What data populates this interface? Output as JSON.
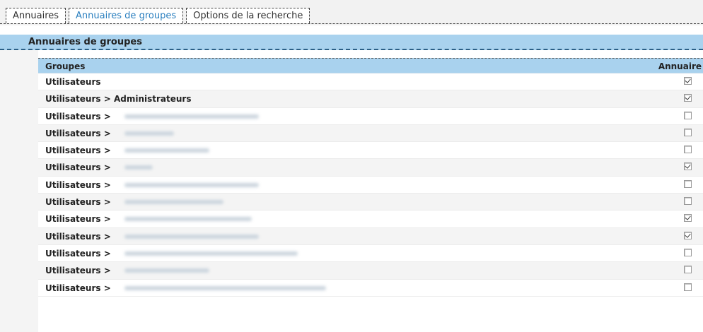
{
  "tabs": [
    {
      "label": "Annuaires",
      "active": false
    },
    {
      "label": "Annuaires de groupes",
      "active": true
    },
    {
      "label": "Options de la recherche",
      "active": false
    }
  ],
  "section": {
    "title": "Annuaires de groupes"
  },
  "table": {
    "headers": {
      "groups": "Groupes",
      "annuaire": "Annuaire"
    },
    "rows": [
      {
        "group": "Utilisateurs",
        "checked": true
      },
      {
        "group": "Utilisateurs > Administrateurs",
        "checked": true
      },
      {
        "group": "Utilisateurs >",
        "checked": false
      },
      {
        "group": "Utilisateurs >",
        "checked": false
      },
      {
        "group": "Utilisateurs >",
        "checked": false
      },
      {
        "group": "Utilisateurs >",
        "checked": true
      },
      {
        "group": "Utilisateurs >",
        "checked": false
      },
      {
        "group": "Utilisateurs >",
        "checked": false
      },
      {
        "group": "Utilisateurs >",
        "checked": true
      },
      {
        "group": "Utilisateurs >",
        "checked": true
      },
      {
        "group": "Utilisateurs >",
        "checked": false
      },
      {
        "group": "Utilisateurs >",
        "checked": false
      },
      {
        "group": "Utilisateurs >",
        "checked": false
      }
    ]
  },
  "colors": {
    "header_blue": "#a9d2ee",
    "active_tab": "#2a7fbf",
    "row_alt": "#f4f4f4"
  }
}
